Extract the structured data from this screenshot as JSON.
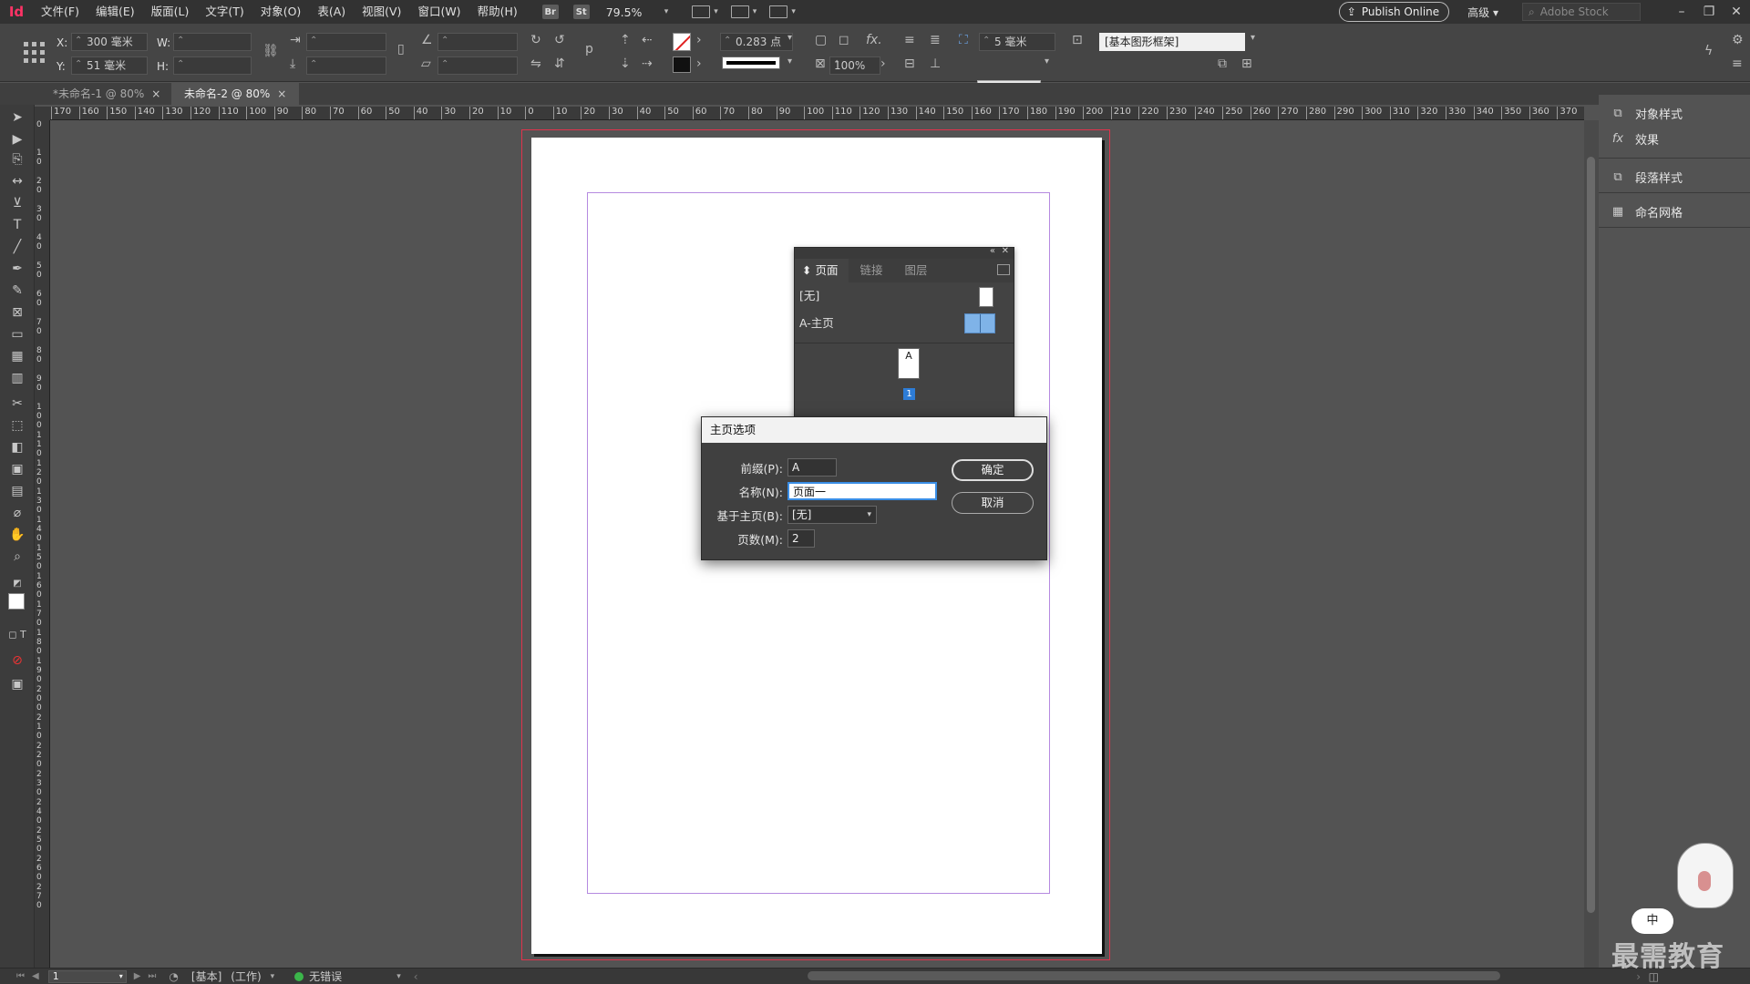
{
  "app": {
    "logo": "Id",
    "accent": "#ff3366"
  },
  "menubar": {
    "items": [
      "文件(F)",
      "编辑(E)",
      "版面(L)",
      "文字(T)",
      "对象(O)",
      "表(A)",
      "视图(V)",
      "窗口(W)",
      "帮助(H)"
    ],
    "bridge_badge": "Br",
    "stock_badge": "St",
    "zoom": "79.5%",
    "publish_label": "Publish Online",
    "workspace": "高级",
    "stock_search_placeholder": "Adobe Stock"
  },
  "control": {
    "x_label": "X:",
    "x_value": "300 毫米",
    "y_label": "Y:",
    "y_value": "51 毫米",
    "w_label": "W:",
    "h_label": "H:",
    "stroke_weight": "0.283 点",
    "opacity": "100%",
    "offset": "5 毫米",
    "object_style": "[基本图形框架]"
  },
  "tabs": [
    {
      "label": "*未命名-1 @ 80%",
      "active": false
    },
    {
      "label": "未命名-2 @ 80%",
      "active": true
    }
  ],
  "ruler": {
    "h_ticks": [
      "170",
      "160",
      "150",
      "140",
      "130",
      "120",
      "110",
      "100",
      "90",
      "80",
      "70",
      "60",
      "50",
      "40",
      "30",
      "20",
      "10",
      "0",
      "10",
      "20",
      "30",
      "40",
      "50",
      "60",
      "70",
      "80",
      "90",
      "100",
      "110",
      "120",
      "130",
      "140",
      "150",
      "160",
      "170",
      "180",
      "190",
      "200",
      "210",
      "220",
      "230",
      "240",
      "250",
      "260",
      "270",
      "280",
      "290",
      "300",
      "310",
      "320",
      "330",
      "340",
      "350",
      "360",
      "370",
      "38"
    ],
    "v_ticks": [
      "0",
      "1\n0",
      "2\n0",
      "3\n0",
      "4\n0",
      "5\n0",
      "6\n0",
      "7\n0",
      "8\n0",
      "9\n0",
      "1\n0\n0",
      "1\n1\n0",
      "1\n2\n0",
      "1\n3\n0",
      "1\n4\n0",
      "1\n5\n0",
      "1\n6\n0",
      "1\n7\n0",
      "1\n8\n0",
      "1\n9\n0",
      "2\n0\n0",
      "2\n1\n0",
      "2\n2\n0",
      "2\n3\n0",
      "2\n4\n0",
      "2\n5\n0",
      "2\n6\n0",
      "2\n7\n0"
    ]
  },
  "right_panel": {
    "items": [
      {
        "label": "对象样式",
        "icon": "object-style-icon"
      },
      {
        "label": "效果",
        "icon": "fx-icon",
        "glyph": "fx"
      },
      {
        "label": "段落样式",
        "icon": "paragraph-style-icon"
      },
      {
        "label": "命名网格",
        "icon": "named-grid-icon"
      }
    ]
  },
  "pages_panel": {
    "tabs": [
      "页面",
      "链接",
      "图层"
    ],
    "masters": [
      "[无]",
      "A-主页"
    ],
    "page_prefix": "A",
    "page_number": "1"
  },
  "dialog": {
    "title": "主页选项",
    "prefix_label": "前缀(P):",
    "prefix_value": "A",
    "name_label": "名称(N):",
    "name_value": "页面一",
    "based_label": "基于主页(B):",
    "based_value": "[无]",
    "pages_label": "页数(M):",
    "pages_value": "2",
    "ok_label": "确定",
    "cancel_label": "取消"
  },
  "status": {
    "page": "1",
    "style": "[基本]",
    "mode": "(工作)",
    "errors": "无错误"
  },
  "watermark": {
    "bubble": "中",
    "text": "最需教育"
  }
}
